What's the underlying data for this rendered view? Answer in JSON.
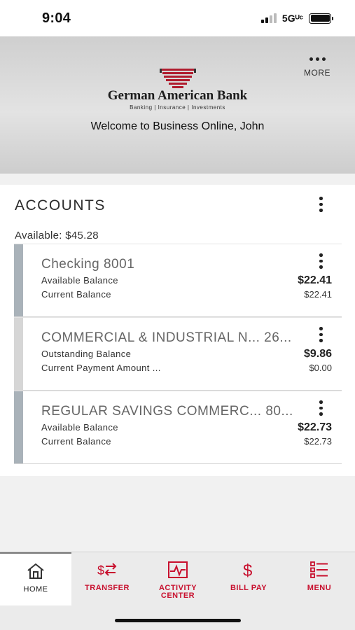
{
  "status_bar": {
    "time": "9:04",
    "network": "5Gᵁᶜ"
  },
  "header": {
    "bank_name": "German American Bank",
    "tagline": "Banking  |  Insurance  |  Investments",
    "welcome": "Welcome to Business Online, John",
    "more_label": "MORE"
  },
  "accounts": {
    "title": "ACCOUNTS",
    "available": "Available: $45.28",
    "items": [
      {
        "name": "Checking 8001",
        "label1": "Available Balance",
        "value1": "$22.41",
        "label2": "Current Balance",
        "value2": "$22.41",
        "bar_color": "#a9b2b9"
      },
      {
        "name": "COMMERCIAL & INDUSTRIAL N...  26...",
        "label1": "Outstanding Balance",
        "value1": "$9.86",
        "label2": "Current Payment Amount ...",
        "value2": "$0.00",
        "bar_color": "#d6d6d6"
      },
      {
        "name": "REGULAR SAVINGS COMMERC...  80...",
        "label1": "Available Balance",
        "value1": "$22.73",
        "label2": "Current Balance",
        "value2": "$22.73",
        "bar_color": "#a9b2b9"
      }
    ]
  },
  "nav": {
    "items": [
      {
        "label": "HOME",
        "icon": "home-icon"
      },
      {
        "label": "TRANSFER",
        "icon": "transfer-icon"
      },
      {
        "label": "ACTIVITY\nCENTER",
        "icon": "activity-icon"
      },
      {
        "label": "BILL PAY",
        "icon": "dollar-icon"
      },
      {
        "label": "MENU",
        "icon": "menu-list-icon"
      }
    ]
  },
  "colors": {
    "accent": "#c8102e",
    "logo_red": "#b01c2e"
  }
}
